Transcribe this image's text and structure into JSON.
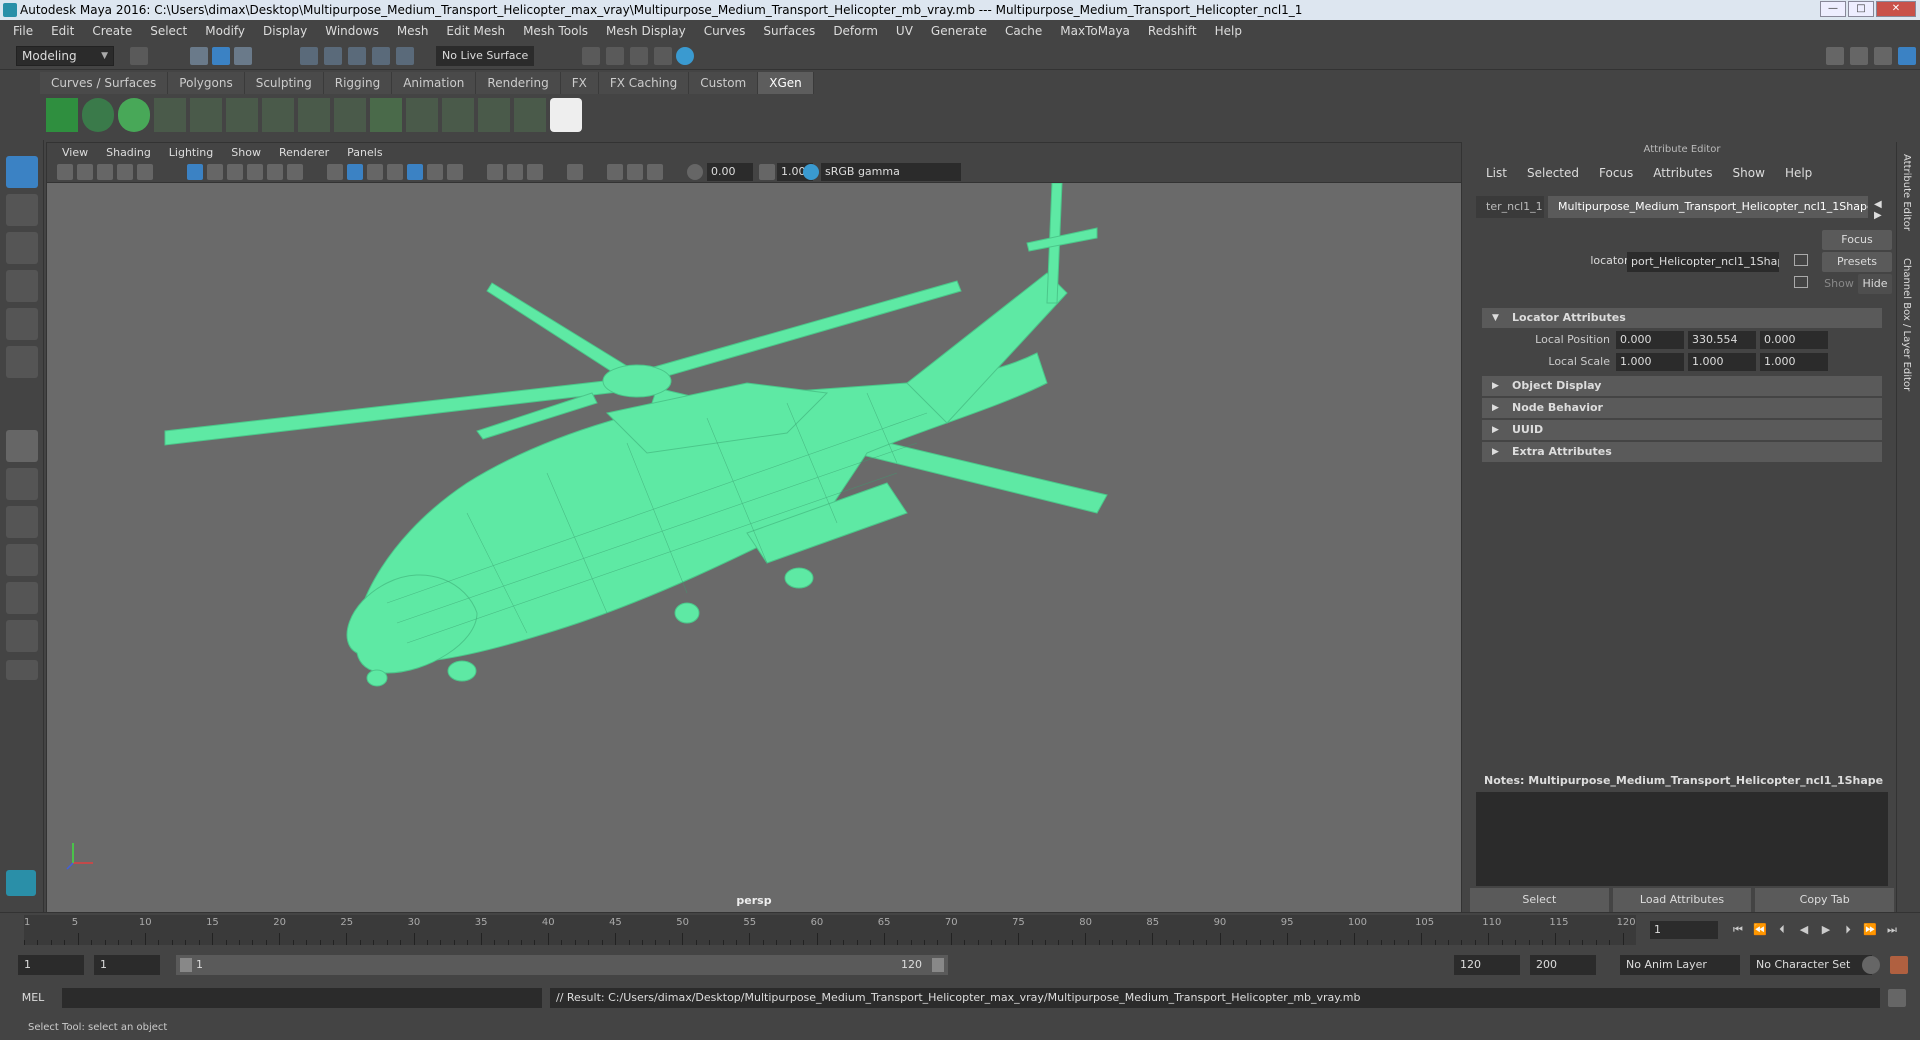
{
  "window": {
    "title": "Autodesk Maya 2016: C:\\Users\\dimax\\Desktop\\Multipurpose_Medium_Transport_Helicopter_max_vray\\Multipurpose_Medium_Transport_Helicopter_mb_vray.mb   ---   Multipurpose_Medium_Transport_Helicopter_ncl1_1"
  },
  "menu": [
    "File",
    "Edit",
    "Create",
    "Select",
    "Modify",
    "Display",
    "Windows",
    "Mesh",
    "Edit Mesh",
    "Mesh Tools",
    "Mesh Display",
    "Curves",
    "Surfaces",
    "Deform",
    "UV",
    "Generate",
    "Cache",
    "MaxToMaya",
    "Redshift",
    "Help"
  ],
  "status_line": {
    "mode": "Modeling",
    "live_surface": "No Live Surface"
  },
  "shelf_tabs": [
    "Curves / Surfaces",
    "Polygons",
    "Sculpting",
    "Rigging",
    "Animation",
    "Rendering",
    "FX",
    "FX Caching",
    "Custom",
    "XGen"
  ],
  "viewport": {
    "menu": [
      "View",
      "Shading",
      "Lighting",
      "Show",
      "Renderer",
      "Panels"
    ],
    "exposure": "0.00",
    "gamma_value": "1.00",
    "color_space": "sRGB gamma",
    "camera": "persp"
  },
  "attribute_editor": {
    "title": "Attribute Editor",
    "menu": [
      "List",
      "Selected",
      "Focus",
      "Attributes",
      "Show",
      "Help"
    ],
    "tab_prev": "ter_ncl1_1",
    "tab_active": "Multipurpose_Medium_Transport_Helicopter_ncl1_1Shape",
    "locator_label": "locator:",
    "locator_value": "port_Helicopter_ncl1_1Shape",
    "focus_btn": "Focus",
    "presets_btn": "Presets",
    "show_btn": "Show",
    "hide_btn": "Hide",
    "sections": {
      "locator_attributes": "Locator Attributes",
      "object_display": "Object Display",
      "node_behavior": "Node Behavior",
      "uuid": "UUID",
      "extra_attributes": "Extra Attributes"
    },
    "local_position": {
      "label": "Local Position",
      "x": "0.000",
      "y": "330.554",
      "z": "0.000"
    },
    "local_scale": {
      "label": "Local Scale",
      "x": "1.000",
      "y": "1.000",
      "z": "1.000"
    },
    "notes": "Notes:  Multipurpose_Medium_Transport_Helicopter_ncl1_1Shape",
    "buttons": {
      "select": "Select",
      "load": "Load Attributes",
      "copy": "Copy Tab"
    },
    "side_labels": {
      "ae": "Attribute Editor",
      "cb": "Channel Box / Layer Editor"
    }
  },
  "timeline": {
    "ticks": [
      "5",
      "10",
      "15",
      "20",
      "25",
      "30",
      "35",
      "40",
      "45",
      "50",
      "55",
      "60",
      "65",
      "70",
      "75",
      "80",
      "85",
      "90",
      "95",
      "100",
      "105",
      "110",
      "115",
      "120"
    ],
    "start_marker": "1",
    "current_frame": "1"
  },
  "range": {
    "start": "1",
    "start_inner": "1",
    "bar_start": "1",
    "bar_end": "120",
    "end_inner": "120",
    "end": "200",
    "anim_layer": "No Anim Layer",
    "char_set": "No Character Set"
  },
  "command_line": {
    "label": "MEL",
    "result": "// Result: C:/Users/dimax/Desktop/Multipurpose_Medium_Transport_Helicopter_max_vray/Multipurpose_Medium_Transport_Helicopter_mb_vray.mb"
  },
  "help_line": "Select Tool: select an object",
  "colors": {
    "wire": "#5ef0a8",
    "viewport_bg": "#6a6a6a",
    "panel": "#444444"
  }
}
